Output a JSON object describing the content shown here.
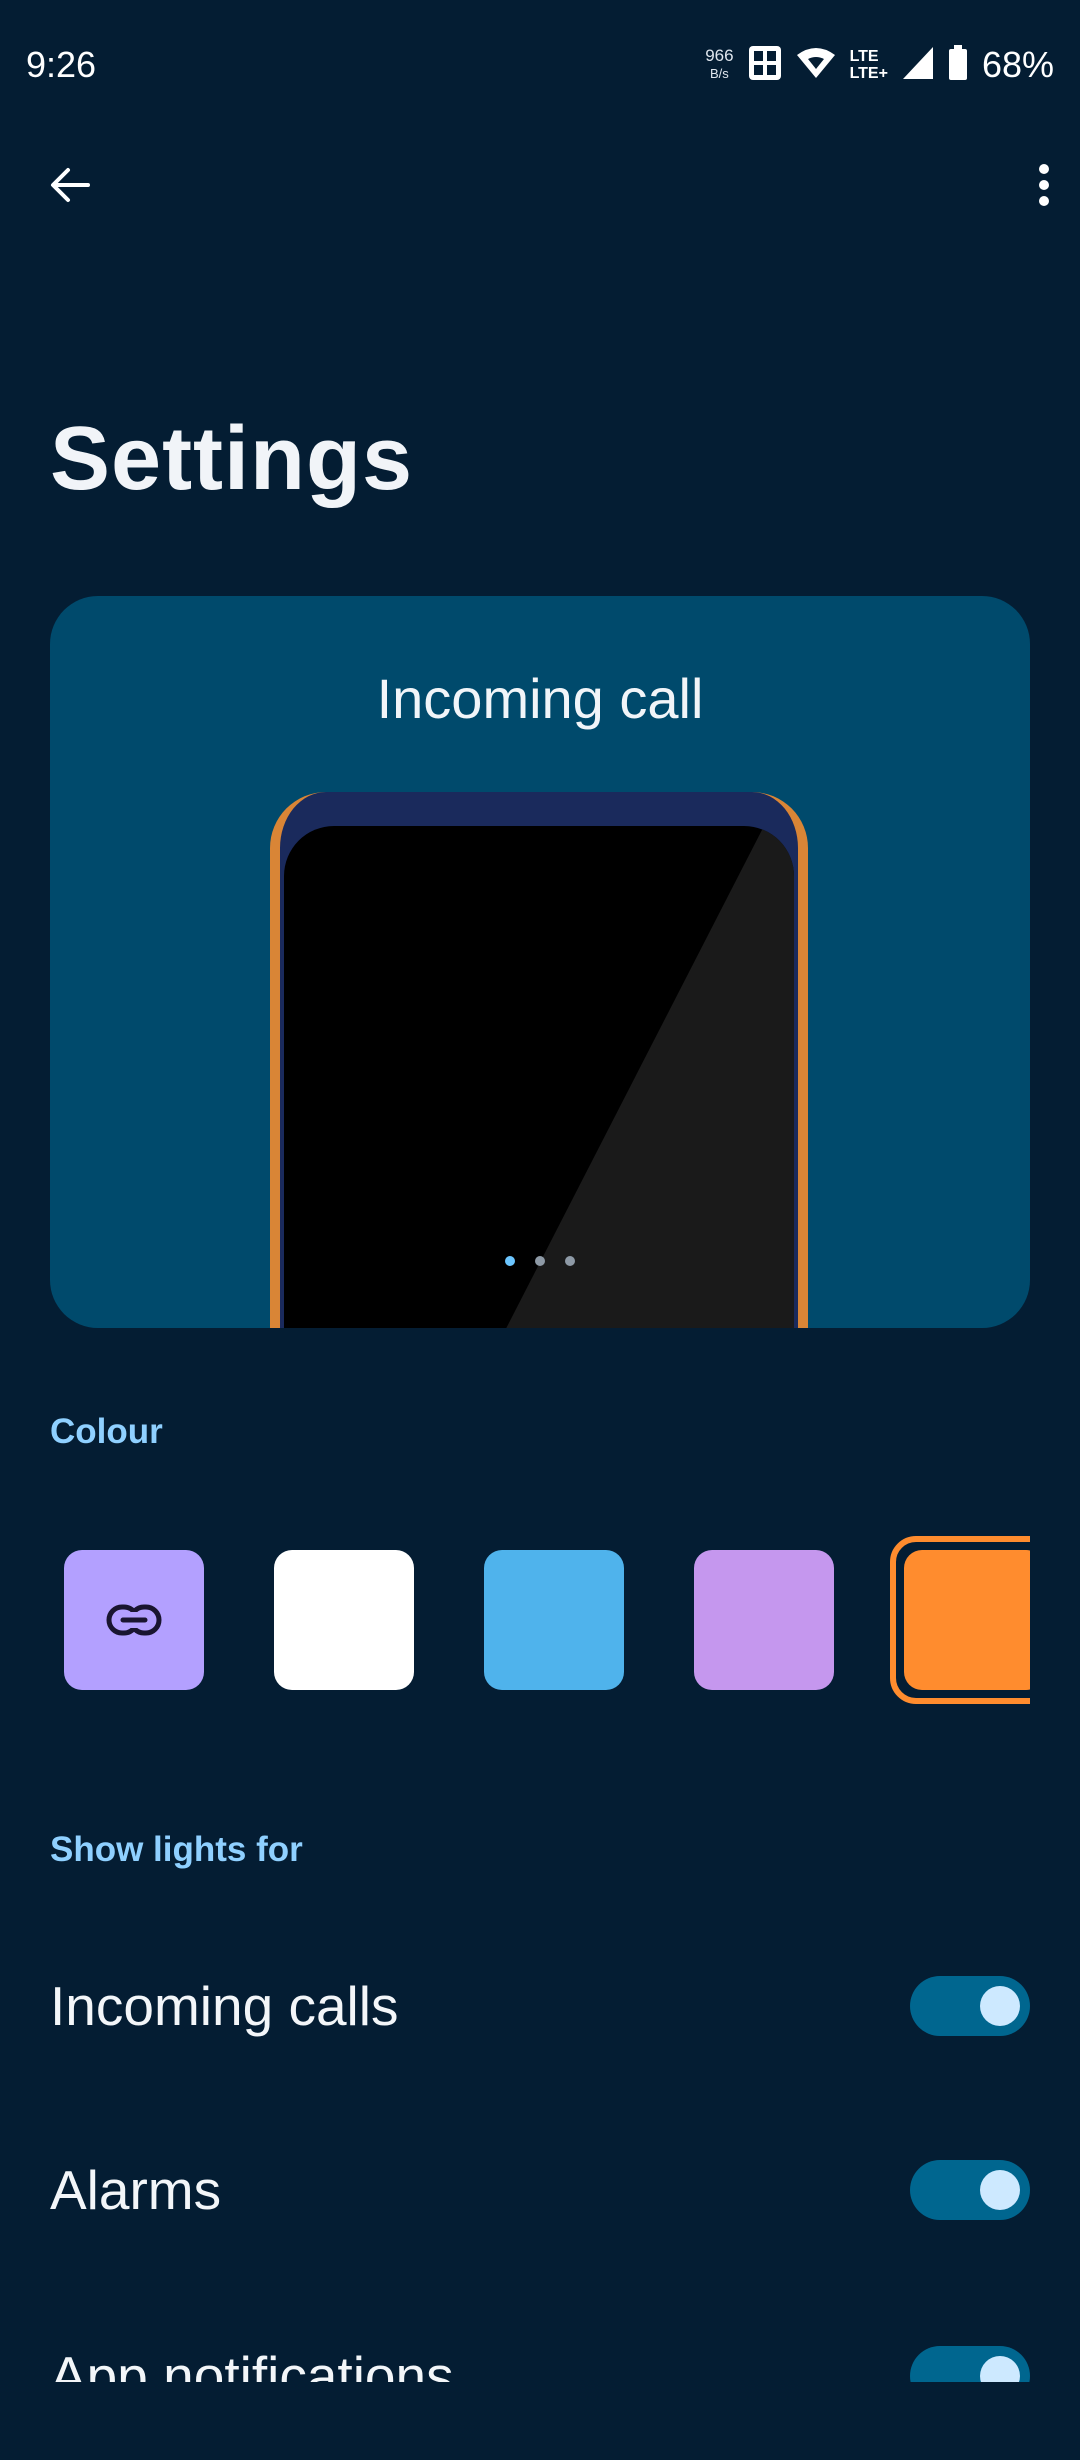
{
  "status_bar": {
    "time": "9:26",
    "net_speed_value": "966",
    "net_speed_unit": "B/s",
    "network_label_top": "LTE",
    "network_label_bottom": "LTE+",
    "battery": "68%"
  },
  "app_bar": {
    "back_icon": "arrow-back-icon",
    "more_icon": "more-vert-icon"
  },
  "page": {
    "title": "Settings"
  },
  "preview": {
    "title": "Incoming call",
    "page_count": 3,
    "active_page": 1
  },
  "colour_section": {
    "header": "Colour",
    "swatches": [
      {
        "color": "#b3a0ff",
        "icon": "link-icon"
      },
      {
        "color": "#ffffff"
      },
      {
        "color": "#4fb3ec"
      },
      {
        "color": "#c597ee"
      },
      {
        "color": "#ff8c2e",
        "selected": true
      }
    ]
  },
  "lights_section": {
    "header": "Show lights for",
    "items": [
      {
        "label": "Incoming calls",
        "enabled": true
      },
      {
        "label": "Alarms",
        "enabled": true
      },
      {
        "label": "App notifications",
        "enabled": true
      }
    ]
  },
  "colors": {
    "background": "#041d33",
    "card": "#004a6c",
    "accent": "#8fd0ff",
    "toggle_track": "#00668f",
    "toggle_knob": "#cde9ff"
  }
}
